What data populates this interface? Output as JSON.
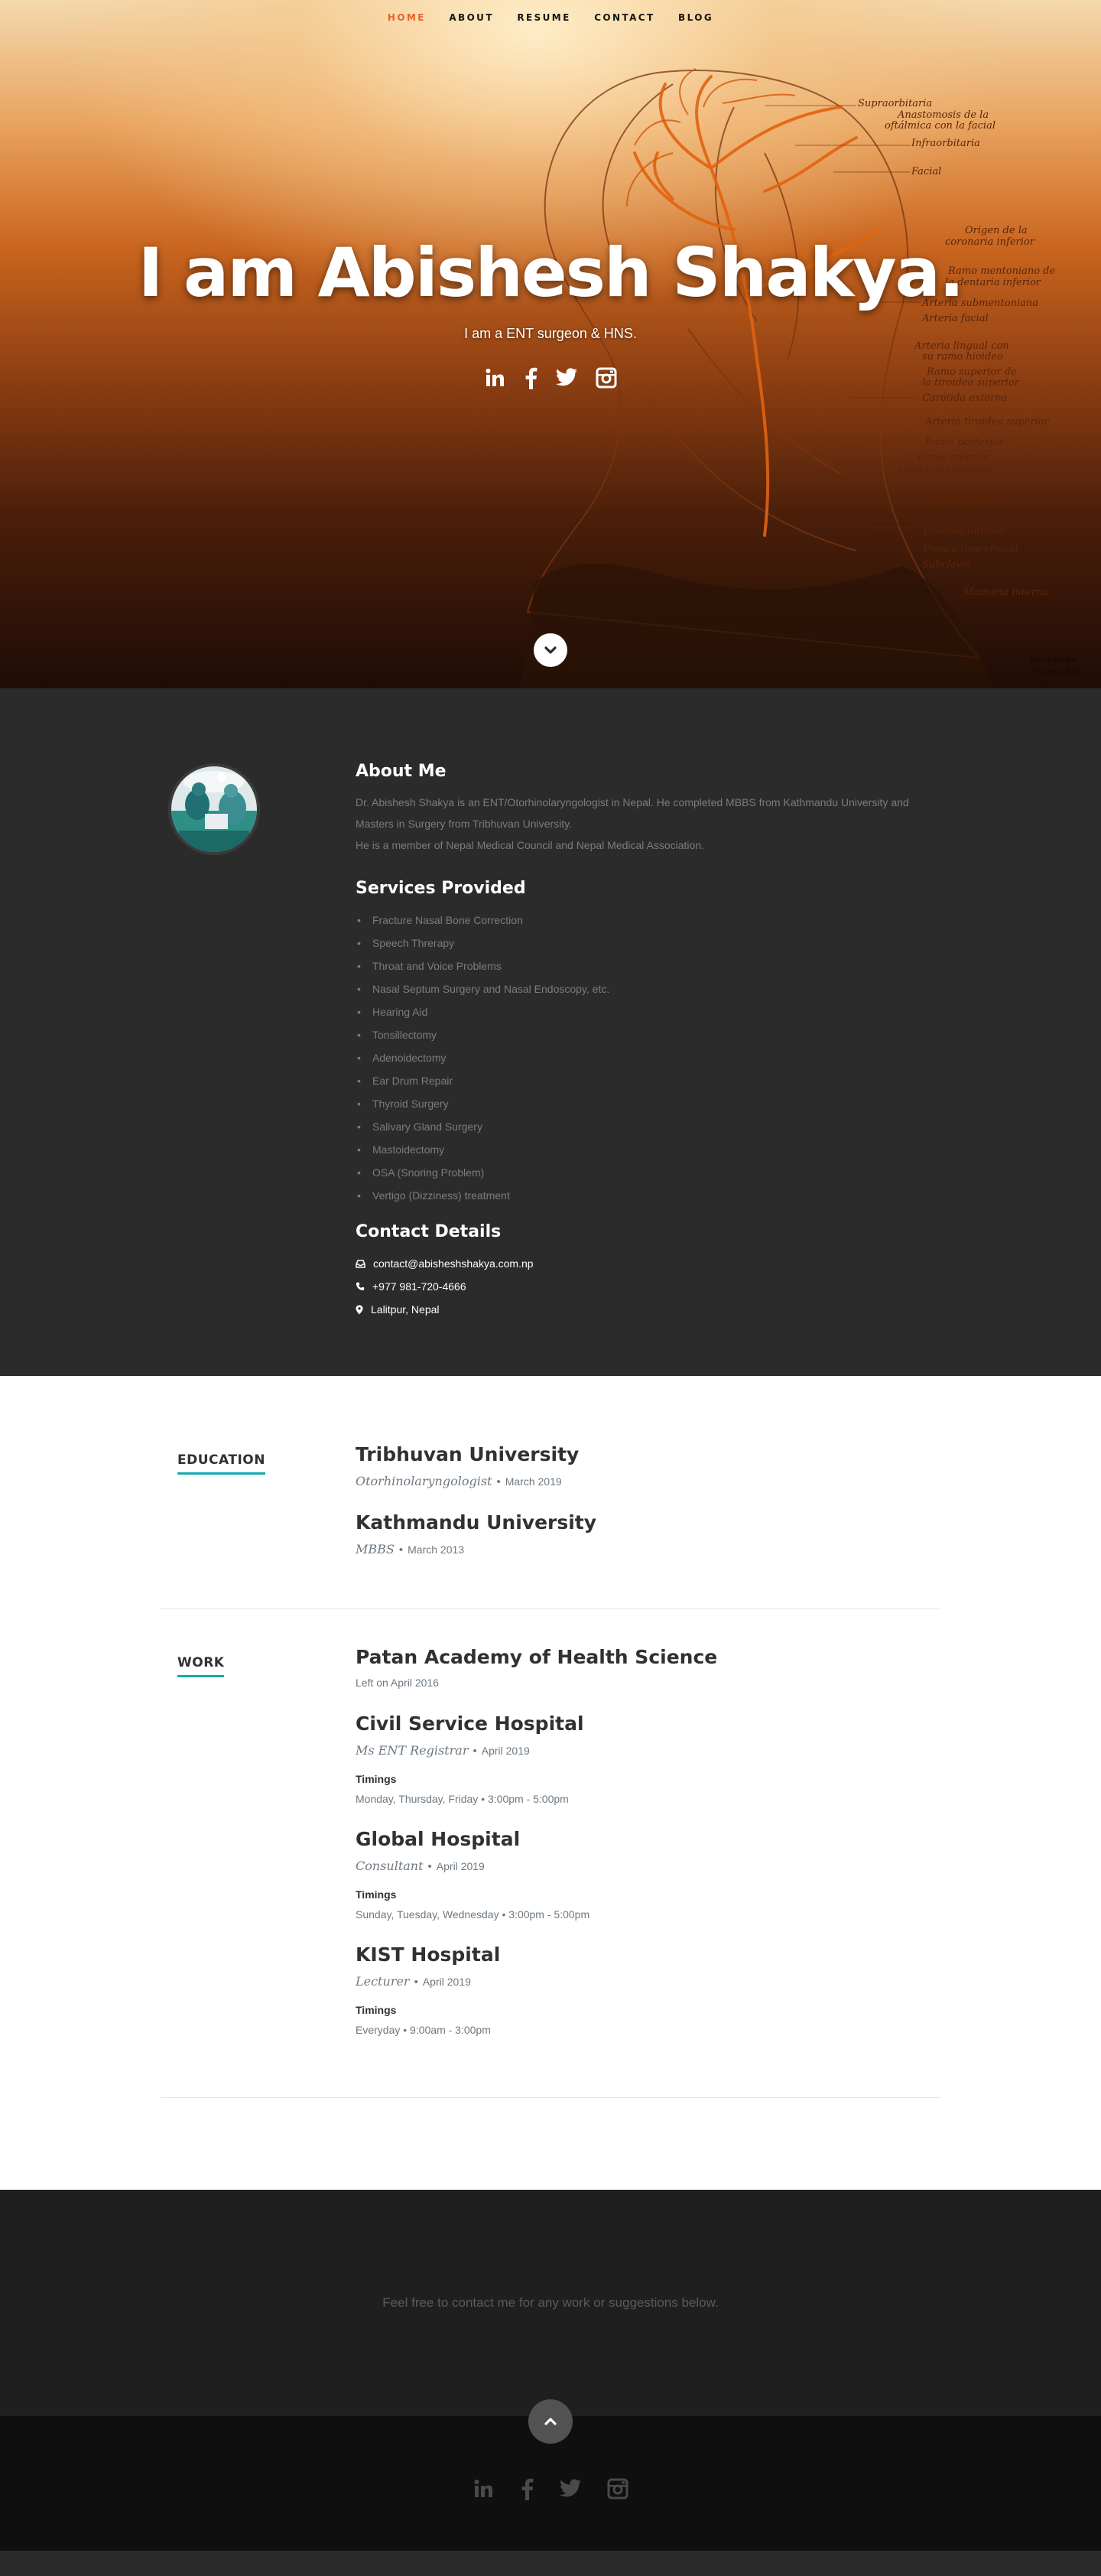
{
  "nav": [
    {
      "label": "HOME",
      "active": true
    },
    {
      "label": "ABOUT",
      "active": false
    },
    {
      "label": "RESUME",
      "active": false
    },
    {
      "label": "CONTACT",
      "active": false
    },
    {
      "label": "BLOG",
      "active": false
    }
  ],
  "hero": {
    "title": "I am Abishesh Shakya.",
    "subtitle": "I am a ENT surgeon & HNS.",
    "social_icons": [
      "linkedin-icon",
      "facebook-icon",
      "twitter-icon",
      "instagram-icon"
    ],
    "illustration_labels": [
      "Supraorbitaria",
      "Anastomosis de la",
      "oftálmica con la facial",
      "Infraorbitaria",
      "Facial",
      "Origen de la",
      "coronaria inferior",
      "Ramo mentoniano de",
      "la dentaria inferior",
      "Arteria submentoniana",
      "Arteria facial",
      "Arteria lingual con",
      "su ramo hioideo",
      "Ramo superior de",
      "la tiroidea superior",
      "Carótida externa",
      "Arteria tiroidea superior",
      "Ramo posterior",
      "Ramo anterior",
      "Glándulas tiroides",
      "Carótida primitiva",
      "Tiroidea inferior",
      "Tronco tirocervical",
      "Subclavia",
      "Mamaria interna"
    ],
    "corner_mark": "Servando Kannabis"
  },
  "about": {
    "heading": "About Me",
    "bio": [
      "Dr. Abishesh Shakya is an ENT/Otorhinolaryngologist in Nepal. He completed MBBS from Kathmandu University and Masters in Surgery from Tribhuvan University.",
      "He is a member of Nepal Medical Council and Nepal Medical Association."
    ],
    "services_heading": "Services Provided",
    "services": [
      "Fracture Nasal Bone Correction",
      "Speech Threrapy",
      "Throat and Voice Problems",
      "Nasal Septum Surgery and Nasal Endoscopy, etc.",
      "Hearing Aid",
      "Tonsillectomy",
      "Adenoidectomy",
      "Ear Drum Repair",
      "Thyroid Surgery",
      "Salivary Gland Surgery",
      "Mastoidectomy",
      "OSA (Snoring Problem)",
      "Vertigo (Dizziness) treatment"
    ],
    "contact_heading": "Contact Details",
    "email": "contact@abisheshshakya.com.np",
    "phone": "+977 981-720-4666",
    "location": "Lalitpur, Nepal"
  },
  "education": {
    "label": "EDUCATION",
    "items": [
      {
        "school": "Tribhuvan University",
        "degree": "Otorhinolaryngologist",
        "date": "March 2019"
      },
      {
        "school": "Kathmandu University",
        "degree": "MBBS",
        "date": "March 2013"
      }
    ]
  },
  "work": {
    "label": "WORK",
    "first": {
      "place": "Patan Academy of Health Science",
      "note": "Left on April 2016"
    },
    "items": [
      {
        "place": "Civil Service Hospital",
        "role": "Ms ENT Registrar",
        "date": "April 2019",
        "timings_label": "Timings",
        "days": "Monday, Thursday, Friday",
        "hours": "3:00pm - 5:00pm"
      },
      {
        "place": "Global Hospital",
        "role": "Consultant",
        "date": "April 2019",
        "timings_label": "Timings",
        "days": "Sunday, Tuesday, Wednesday",
        "hours": "3:00pm - 5:00pm"
      },
      {
        "place": "KIST Hospital",
        "role": "Lecturer",
        "date": "April 2019",
        "timings_label": "Timings",
        "days": "Everyday",
        "hours": "9:00am - 3:00pm"
      }
    ]
  },
  "call_to_action": "Feel free to contact me for any work or suggestions below.",
  "footer": {
    "social_icons": [
      "linkedin-icon",
      "facebook-icon",
      "twitter-icon",
      "instagram-icon"
    ]
  },
  "colors": {
    "accent": "#e4632a",
    "underline": "#11abb0",
    "dark_section": "#2b2b2b",
    "footer": "#0f0f0f"
  }
}
